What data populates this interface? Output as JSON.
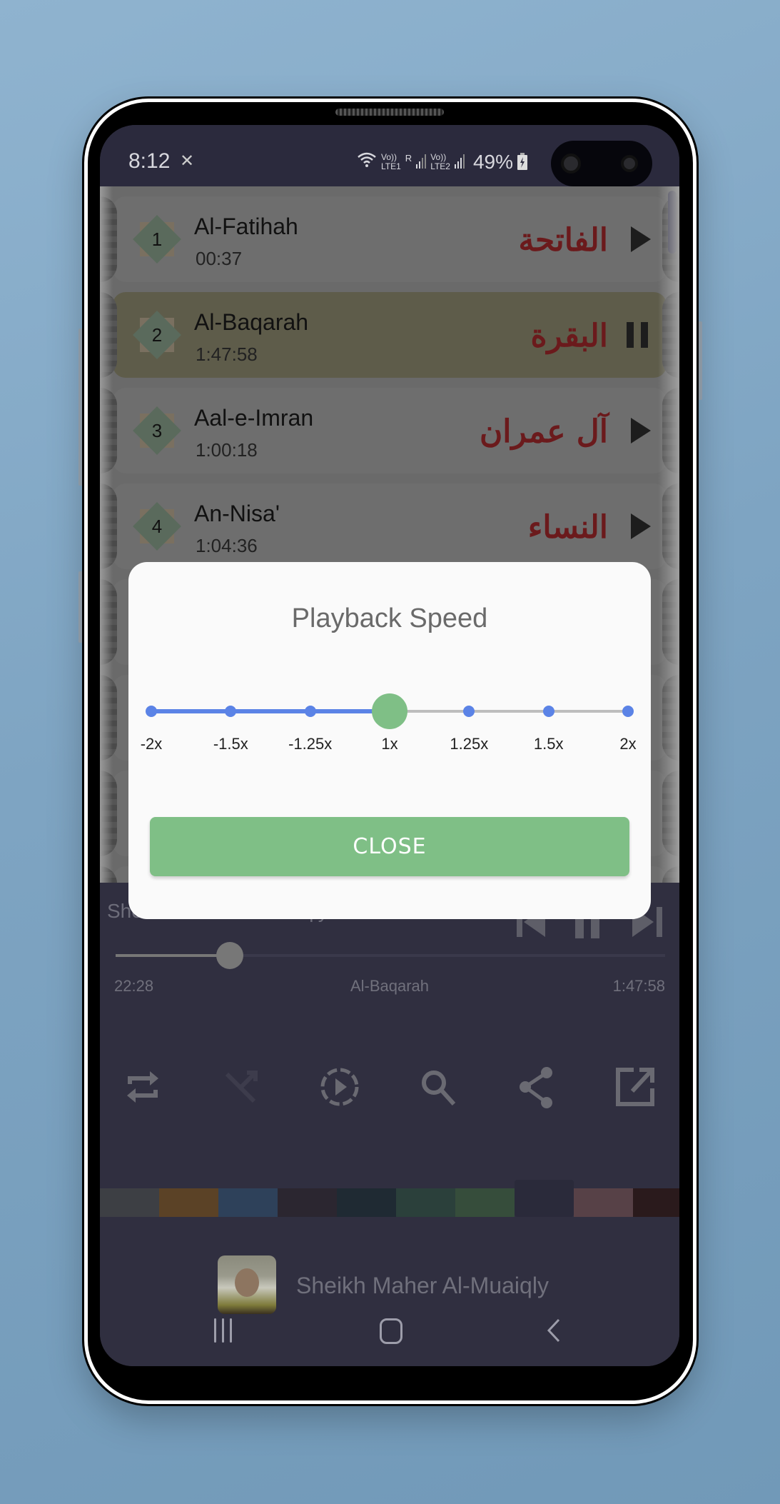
{
  "status_bar": {
    "time": "8:12",
    "network_1": "LTE1",
    "network_2": "LTE2",
    "volte": "Vo))",
    "roaming": "R",
    "battery": "49%"
  },
  "suras": [
    {
      "number": "1",
      "name": "Al-Fatihah",
      "duration": "00:37",
      "arabic": "الفاتحة",
      "state": "play"
    },
    {
      "number": "2",
      "name": "Al-Baqarah",
      "duration": "1:47:58",
      "arabic": "البقرة",
      "state": "pause"
    },
    {
      "number": "3",
      "name": "Aal-e-Imran",
      "duration": "1:00:18",
      "arabic": "آل عمران",
      "state": "play"
    },
    {
      "number": "4",
      "name": "An-Nisa'",
      "duration": "1:04:36",
      "arabic": "النساء",
      "state": "play"
    }
  ],
  "player": {
    "reciter": "Sheikh Maher Al-Muaiqly",
    "current_time": "22:28",
    "track_title": "Al-Baqarah",
    "total_time": "1:47:58",
    "progress": 0.208,
    "tools": [
      "repeat-icon",
      "shuffle-icon",
      "autoplay-icon",
      "search-icon",
      "share-icon",
      "open-external-icon"
    ],
    "theme_colors": [
      "#3d3f44",
      "#5b4226",
      "#2e415a",
      "#2b2630",
      "#1f2a33",
      "#2b403b",
      "#364d3b",
      "#2a2a3a",
      "#574147",
      "#2a1a1c"
    ],
    "selected_theme_index": 7
  },
  "reciter_row": {
    "name": "Sheikh Maher Al-Muaiqly"
  },
  "dialog": {
    "title": "Playback Speed",
    "speeds": [
      "-2x",
      "-1.5x",
      "-1.25x",
      "1x",
      "1.25x",
      "1.5x",
      "2x"
    ],
    "selected_index": 3,
    "close_label": "CLOSE",
    "accent_color": "#5b83e6",
    "thumb_color": "#7fbf86"
  }
}
